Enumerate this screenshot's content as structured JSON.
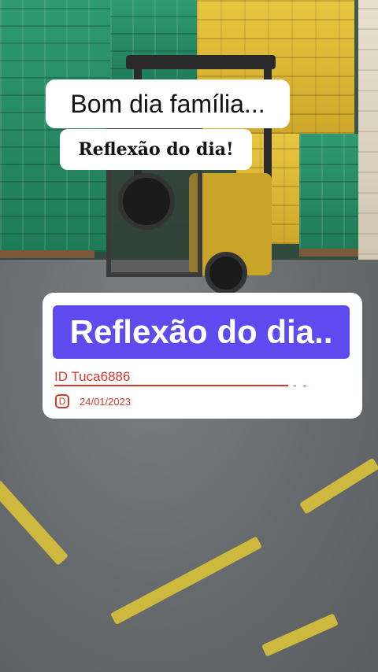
{
  "overlay": {
    "greeting": "Bom dia família...",
    "subtitle": "Reflexão do dia!"
  },
  "card": {
    "title": "Reflexão do dia..",
    "id_label": "ID  Tuca6886",
    "dashes": "- -",
    "badge_letter": "D",
    "date": "24/01/2023"
  },
  "colors": {
    "banner": "#5f4af0",
    "id_text": "#d33a2c",
    "floor_stripe": "#d9c23a"
  },
  "scene": {
    "description_icon": "forklift-icon"
  }
}
